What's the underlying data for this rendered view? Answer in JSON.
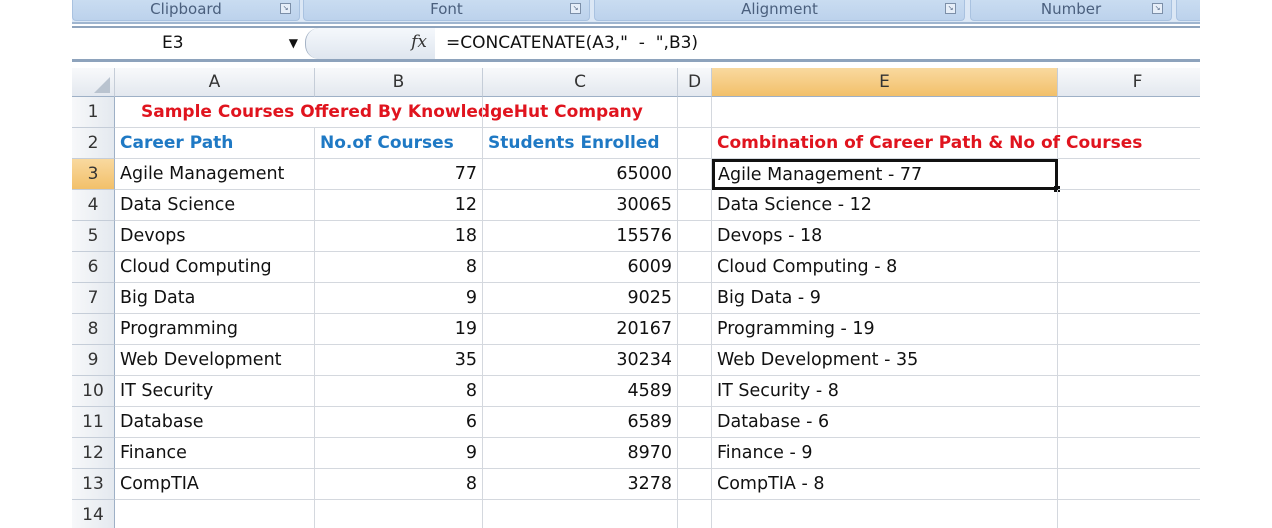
{
  "ribbon": {
    "groups": [
      "Clipboard",
      "Font",
      "Alignment",
      "Number"
    ]
  },
  "formula_bar": {
    "name_box": "E3",
    "fx_label": "fx",
    "formula": "=CONCATENATE(A3,\"  -  \",B3)"
  },
  "columns": [
    "A",
    "B",
    "C",
    "D",
    "E",
    "F"
  ],
  "selected_cell": "E3",
  "title": "Sample Courses Offered By KnowledgeHut Company",
  "headers": {
    "a": "Career Path",
    "b": "No.of Courses",
    "c": "Students Enrolled",
    "e": "Combination of Career Path & No of Courses"
  },
  "rows": [
    {
      "a": "Agile Management",
      "b": "77",
      "c": "65000",
      "e": "Agile Management  -  77"
    },
    {
      "a": "Data Science",
      "b": "12",
      "c": "30065",
      "e": "Data Science  -  12"
    },
    {
      "a": "Devops",
      "b": "18",
      "c": "15576",
      "e": "Devops  -  18"
    },
    {
      "a": "Cloud Computing",
      "b": "8",
      "c": "6009",
      "e": "Cloud Computing  -  8"
    },
    {
      "a": "Big Data",
      "b": "9",
      "c": "9025",
      "e": "Big Data  -  9"
    },
    {
      "a": "Programming",
      "b": "19",
      "c": "20167",
      "e": "Programming  -  19"
    },
    {
      "a": "Web Development",
      "b": "35",
      "c": "30234",
      "e": "Web Development  -  35"
    },
    {
      "a": "IT Security",
      "b": "8",
      "c": "4589",
      "e": "IT Security  -  8"
    },
    {
      "a": "Database",
      "b": "6",
      "c": "6589",
      "e": "Database  -  6"
    },
    {
      "a": "Finance",
      "b": "9",
      "c": "8970",
      "e": "Finance  -  9"
    },
    {
      "a": "CompTIA",
      "b": "8",
      "c": "3278",
      "e": "CompTIA  -  8"
    }
  ],
  "row_numbers": [
    "1",
    "2",
    "3",
    "4",
    "5",
    "6",
    "7",
    "8",
    "9",
    "10",
    "11",
    "12",
    "13",
    "14"
  ]
}
